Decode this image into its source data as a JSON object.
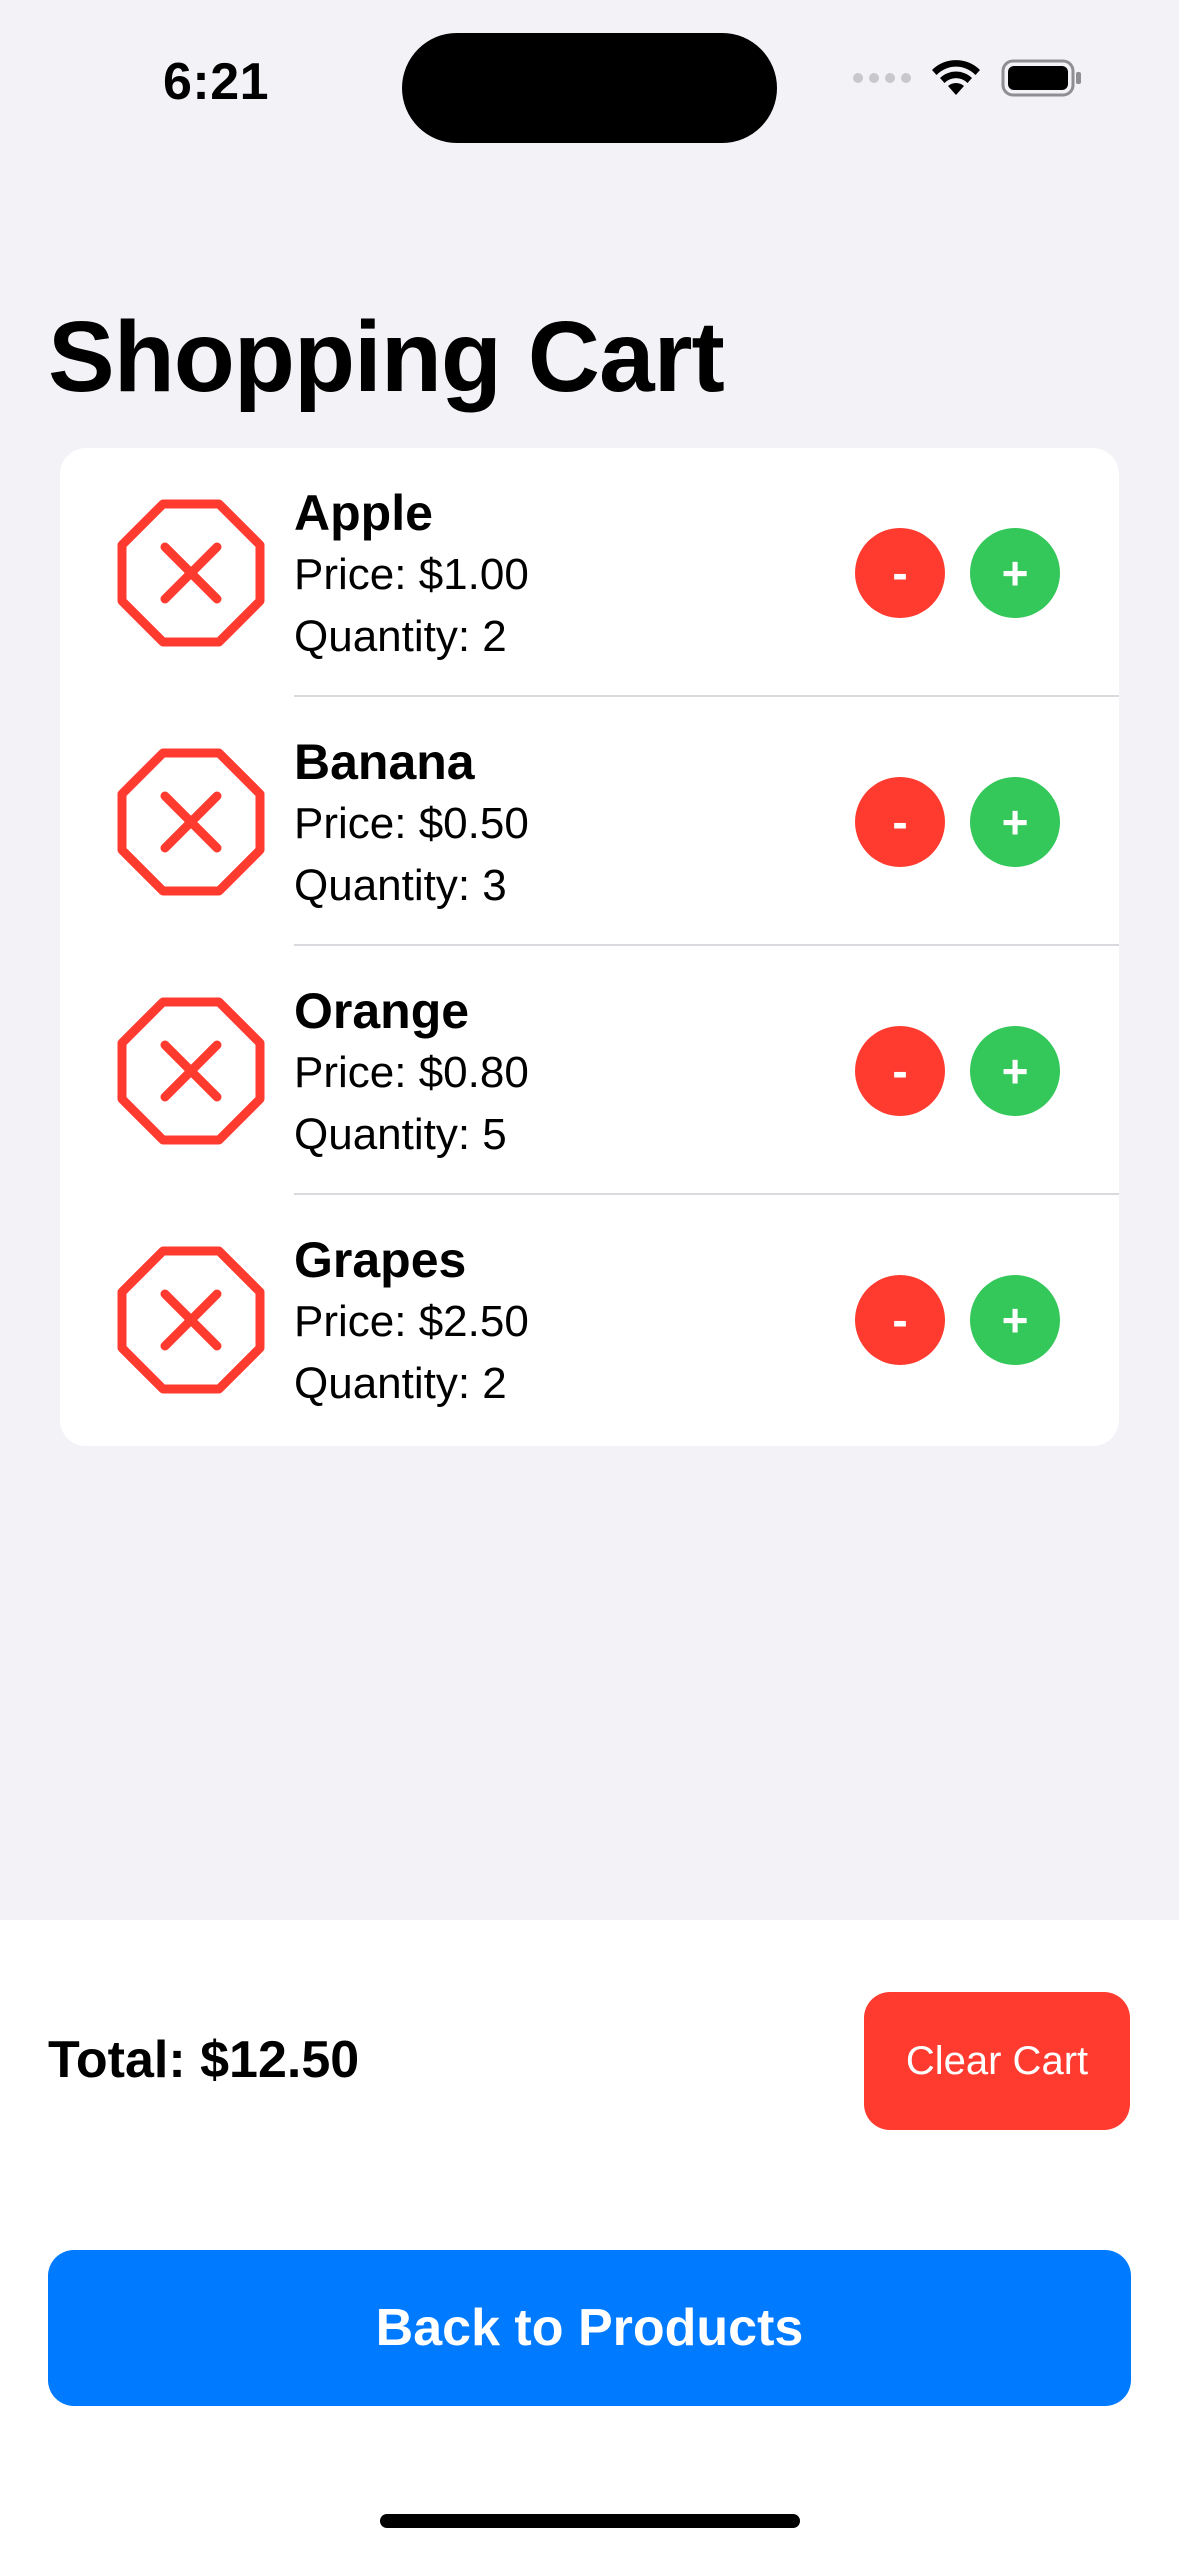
{
  "status_bar": {
    "time": "6:21"
  },
  "header": {
    "title": "Shopping Cart"
  },
  "cart": {
    "items": [
      {
        "name": "Apple",
        "price_text": "Price: $1.00",
        "quantity_text": "Quantity: 2",
        "minus_label": "-",
        "plus_label": "+"
      },
      {
        "name": "Banana",
        "price_text": "Price: $0.50",
        "quantity_text": "Quantity: 3",
        "minus_label": "-",
        "plus_label": "+"
      },
      {
        "name": "Orange",
        "price_text": "Price: $0.80",
        "quantity_text": "Quantity: 5",
        "minus_label": "-",
        "plus_label": "+"
      },
      {
        "name": "Grapes",
        "price_text": "Price: $2.50",
        "quantity_text": "Quantity: 2",
        "minus_label": "-",
        "plus_label": "+"
      }
    ]
  },
  "footer": {
    "total_text": "Total: $12.50",
    "clear_label": "Clear Cart",
    "back_label": "Back to Products"
  },
  "icons": {
    "remove": "xmark-octagon-icon",
    "wifi": "wifi-icon",
    "battery": "battery-icon",
    "signal": "cellular-signal-icon"
  },
  "colors": {
    "destructive": "#ff3b30",
    "positive": "#34c759",
    "accent": "#007aff",
    "background": "#f2f2f7"
  }
}
